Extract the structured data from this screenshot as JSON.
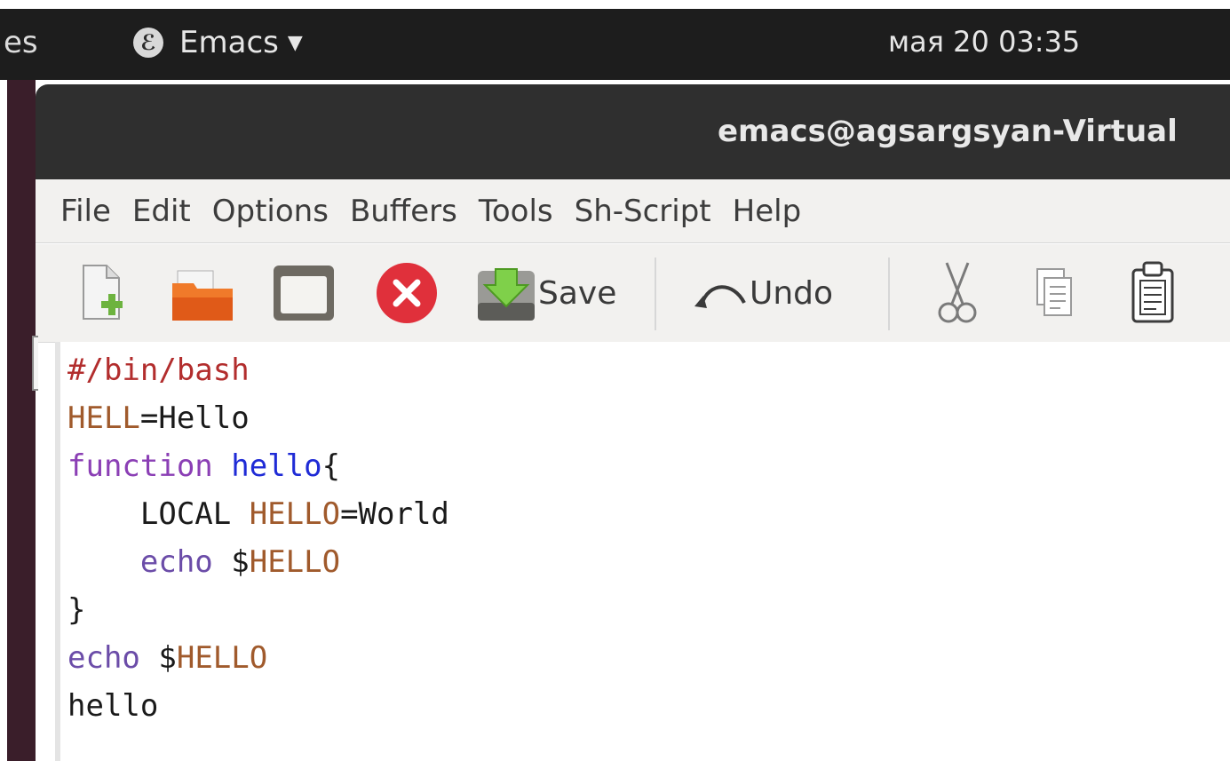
{
  "topbar": {
    "activities_label": "es",
    "app_name": "Emacs",
    "app_icon_glyph": "ℰ",
    "caret": "▼",
    "clock": "мая 20  03:35"
  },
  "window": {
    "title": "emacs@agsargsyan-Virtual"
  },
  "menu": {
    "items": [
      "File",
      "Edit",
      "Options",
      "Buffers",
      "Tools",
      "Sh-Script",
      "Help"
    ]
  },
  "toolbar": {
    "save_label": "Save",
    "undo_label": "Undo",
    "icons": [
      "new-file-icon",
      "open-folder-icon",
      "dired-icon",
      "close-buffer-icon",
      "save-icon",
      "undo-icon",
      "cut-icon",
      "copy-icon",
      "paste-icon"
    ]
  },
  "editor": {
    "lines": [
      [
        {
          "t": "#/bin/bash",
          "c": "comment"
        }
      ],
      [
        {
          "t": "HELL",
          "c": "var"
        },
        {
          "t": "=Hello",
          "c": "plain"
        }
      ],
      [
        {
          "t": "function",
          "c": "kw"
        },
        {
          "t": " ",
          "c": "plain"
        },
        {
          "t": "hello",
          "c": "fn"
        },
        {
          "t": "{",
          "c": "plain"
        }
      ],
      [
        {
          "t": "    LOCAL ",
          "c": "plain"
        },
        {
          "t": "HELLO",
          "c": "var"
        },
        {
          "t": "=World",
          "c": "plain"
        }
      ],
      [
        {
          "t": "    ",
          "c": "plain"
        },
        {
          "t": "echo",
          "c": "builtin"
        },
        {
          "t": " $",
          "c": "plain"
        },
        {
          "t": "HELLO",
          "c": "var"
        }
      ],
      [
        {
          "t": "}",
          "c": "plain"
        }
      ],
      [
        {
          "t": "echo",
          "c": "builtin"
        },
        {
          "t": " $",
          "c": "plain"
        },
        {
          "t": "HELLO",
          "c": "var"
        }
      ],
      [
        {
          "t": "hello",
          "c": "plain"
        }
      ]
    ]
  },
  "colors": {
    "comment": "#b22d2d",
    "variable": "#a05a2c",
    "keyword": "#8b3fb5",
    "function_name": "#1f2bd6",
    "builtin": "#6b4ca8",
    "close_button": "#e0303b",
    "topbar_bg": "#1d1d1d",
    "titlebar_bg": "#2f2f2f"
  }
}
